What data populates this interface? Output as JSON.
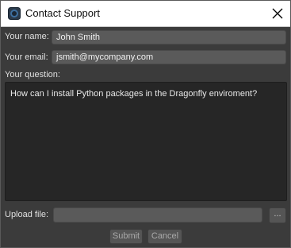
{
  "window": {
    "title": "Contact Support",
    "icons": {
      "app": "dragonfly-app-icon",
      "close": "close-icon"
    }
  },
  "form": {
    "name_label": "Your name:",
    "name_value": "John Smith",
    "email_label": "Your email:",
    "email_value": "jsmith@mycompany.com",
    "question_label": "Your question:",
    "question_value": "How can I install Python packages in the Dragonfly enviroment?",
    "upload_label": "Upload file:",
    "upload_value": "",
    "browse_label": "..."
  },
  "actions": {
    "submit_label": "Submit",
    "cancel_label": "Cancel"
  },
  "colors": {
    "background": "#3b3b3b",
    "field": "#5a5a5a",
    "textarea": "#262626",
    "titlebar": "#ffffff"
  }
}
